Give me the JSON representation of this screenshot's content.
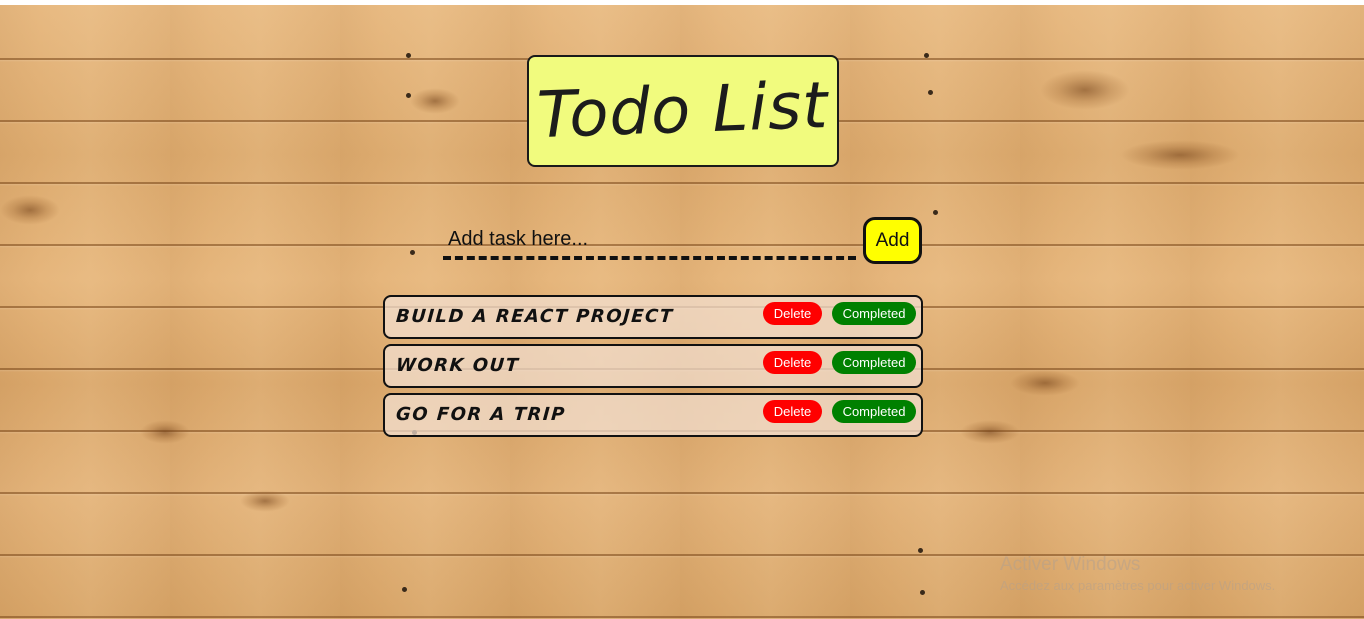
{
  "app": {
    "title": "Todo List"
  },
  "input": {
    "placeholder": "Add task here...",
    "value": ""
  },
  "add_button": {
    "label": "Add"
  },
  "todos": [
    {
      "text": "Build a React project",
      "delete_label": "Delete",
      "completed_label": "Completed"
    },
    {
      "text": "Work out",
      "delete_label": "Delete",
      "completed_label": "Completed"
    },
    {
      "text": "Go for a trip",
      "delete_label": "Delete",
      "completed_label": "Completed"
    }
  ],
  "watermark": {
    "title": "Activer Windows",
    "subtitle": "Accédez aux paramètres pour activer Windows."
  },
  "colors": {
    "title_bg": "#f1fb7e",
    "add_bg": "#ffff00",
    "delete_bg": "#ff0000",
    "completed_bg": "#008000",
    "wood": "#e2b179"
  }
}
